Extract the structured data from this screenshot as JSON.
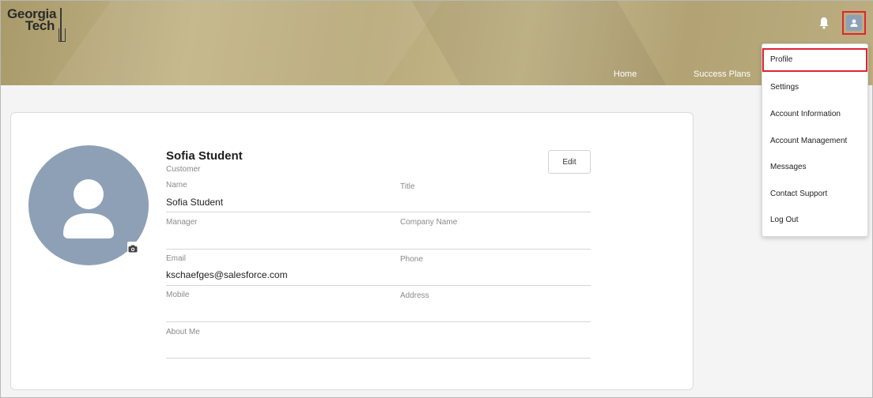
{
  "header": {
    "logo_line1": "Georgia",
    "logo_line2": "Tech",
    "nav": {
      "home": "Home",
      "success_plans": "Success Plans"
    }
  },
  "profile": {
    "display_name": "Sofia Student",
    "subtitle": "Customer",
    "edit_label": "Edit",
    "fields": {
      "name": {
        "label": "Name",
        "value": "Sofia Student"
      },
      "title": {
        "label": "Title",
        "value": ""
      },
      "manager": {
        "label": "Manager",
        "value": ""
      },
      "company": {
        "label": "Company Name",
        "value": ""
      },
      "email": {
        "label": "Email",
        "value": "kschaefges@salesforce.com"
      },
      "phone": {
        "label": "Phone",
        "value": ""
      },
      "mobile": {
        "label": "Mobile",
        "value": ""
      },
      "address": {
        "label": "Address",
        "value": ""
      },
      "about": {
        "label": "About Me",
        "value": ""
      }
    }
  },
  "user_menu": {
    "items": [
      {
        "label": "Profile"
      },
      {
        "label": "Settings"
      },
      {
        "label": "Account Information"
      },
      {
        "label": "Account Management"
      },
      {
        "label": "Messages"
      },
      {
        "label": "Contact Support"
      },
      {
        "label": "Log Out"
      }
    ],
    "active_index": 0
  },
  "colors": {
    "header_gold": "#b8a978",
    "avatar_bg": "#8ea0b6",
    "highlight_red": "#e3232f"
  },
  "icons": [
    "bell-icon",
    "user-icon",
    "person-icon",
    "camera-icon"
  ]
}
